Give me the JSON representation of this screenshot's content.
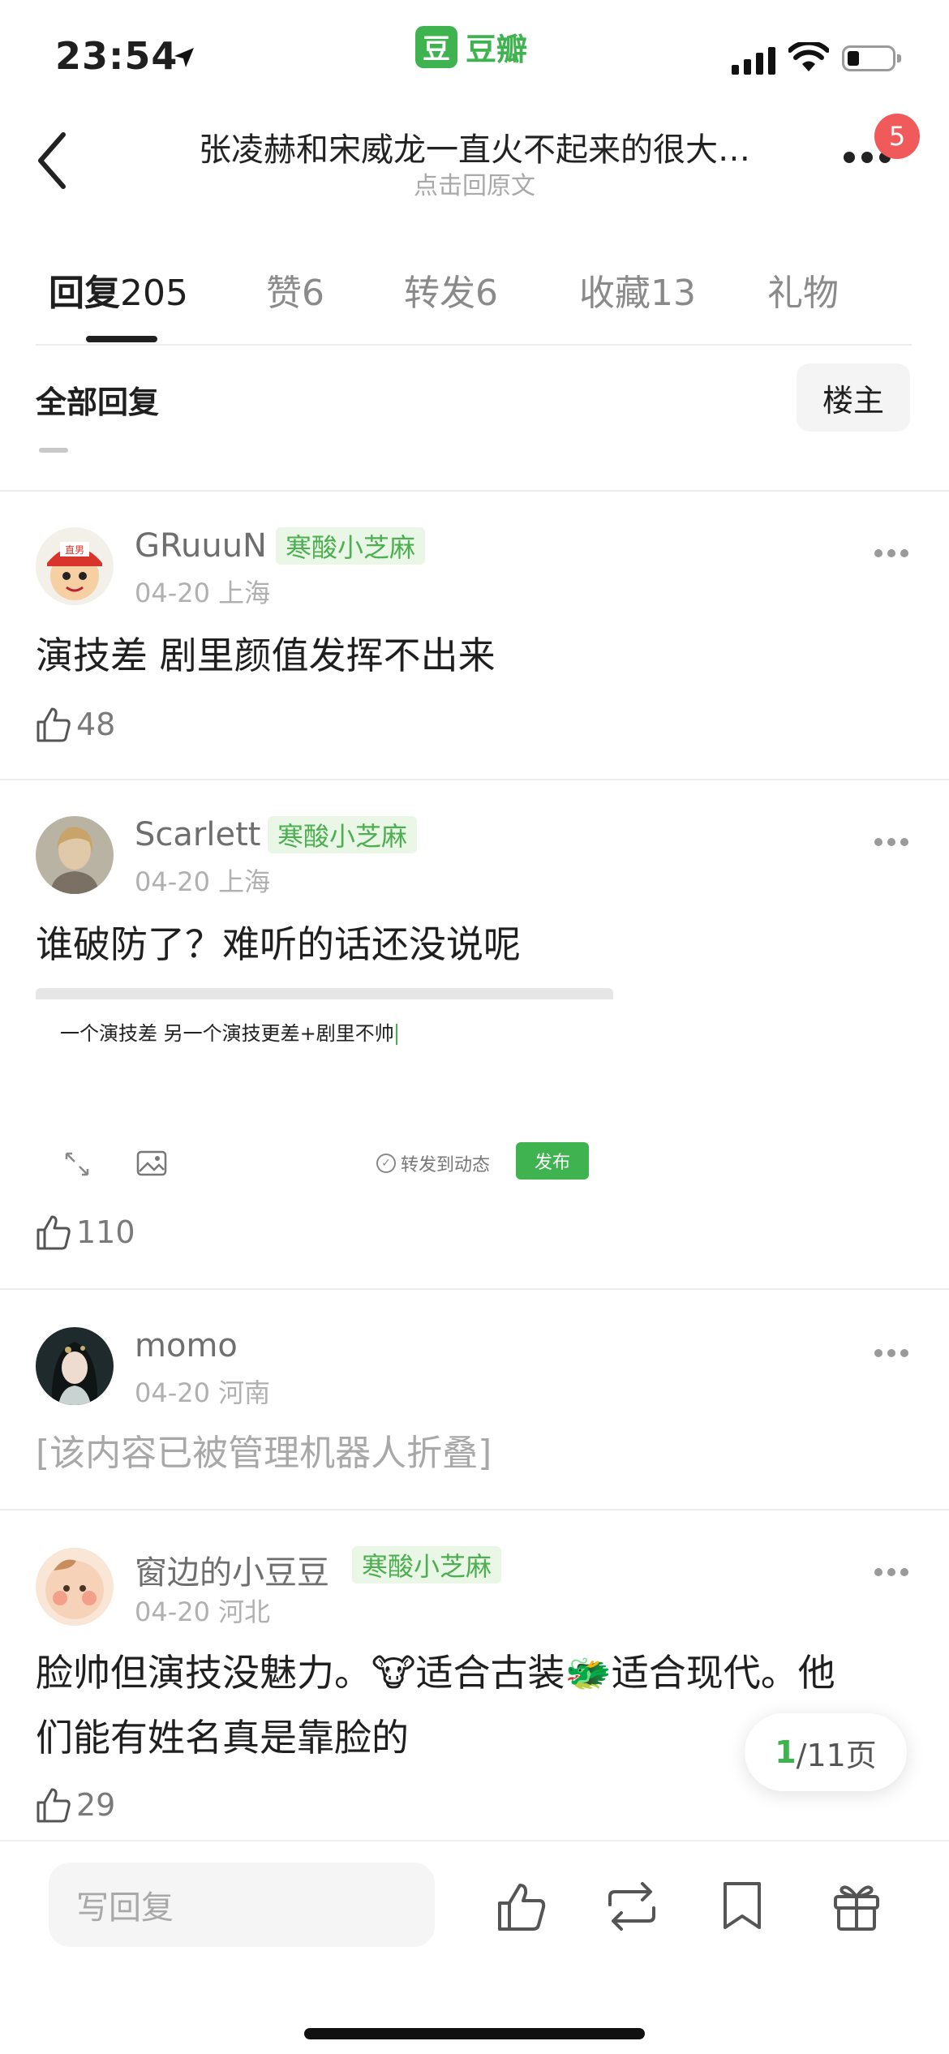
{
  "status": {
    "time": "23:54"
  },
  "app": {
    "logo_char": "豆",
    "name": "豆瓣"
  },
  "nav": {
    "title": "张凌赫和宋威龙一直火不起来的很大…",
    "subtitle": "点击回原文",
    "badge": "5"
  },
  "tabs": [
    {
      "label": "回复",
      "count": "205"
    },
    {
      "label": "赞",
      "count": "6"
    },
    {
      "label": "转发",
      "count": "6"
    },
    {
      "label": "收藏",
      "count": "13"
    },
    {
      "label": "礼物",
      "count": ""
    }
  ],
  "filter": {
    "all": "全部回复",
    "op": "楼主"
  },
  "comments": [
    {
      "user": "GRuuuN",
      "tag": "寒酸小芝麻",
      "date": "04-20",
      "location": "上海",
      "avatar_text": "直男",
      "text": "演技差 剧里颜值发挥不出来",
      "likes": "48"
    },
    {
      "user": "Scarlett",
      "tag": "寒酸小芝麻",
      "date": "04-20",
      "location": "上海",
      "text": "谁破防了？难听的话还没说呢",
      "embed": {
        "text": "一个演技差 另一个演技更差+剧里不帅",
        "forward": "转发到动态",
        "publish": "发布"
      },
      "likes": "110"
    },
    {
      "user": "momo",
      "date": "04-20",
      "location": "河南",
      "text": "[该内容已被管理机器人折叠]"
    },
    {
      "user": "窗边的小豆豆",
      "tag": "寒酸小芝麻",
      "date": "04-20",
      "location": "河北",
      "text_line1_a": "脸帅但演技没魅力。",
      "emoji1": "🐮",
      "text_line1_b": "适合古装",
      "emoji2": "🐲",
      "text_line1_c": "适合现代。他",
      "text_line2": "们能有姓名真是靠脸的",
      "likes": "29"
    }
  ],
  "pager": {
    "current": "1",
    "total": "/11页"
  },
  "bottom": {
    "reply_placeholder": "写回复"
  }
}
